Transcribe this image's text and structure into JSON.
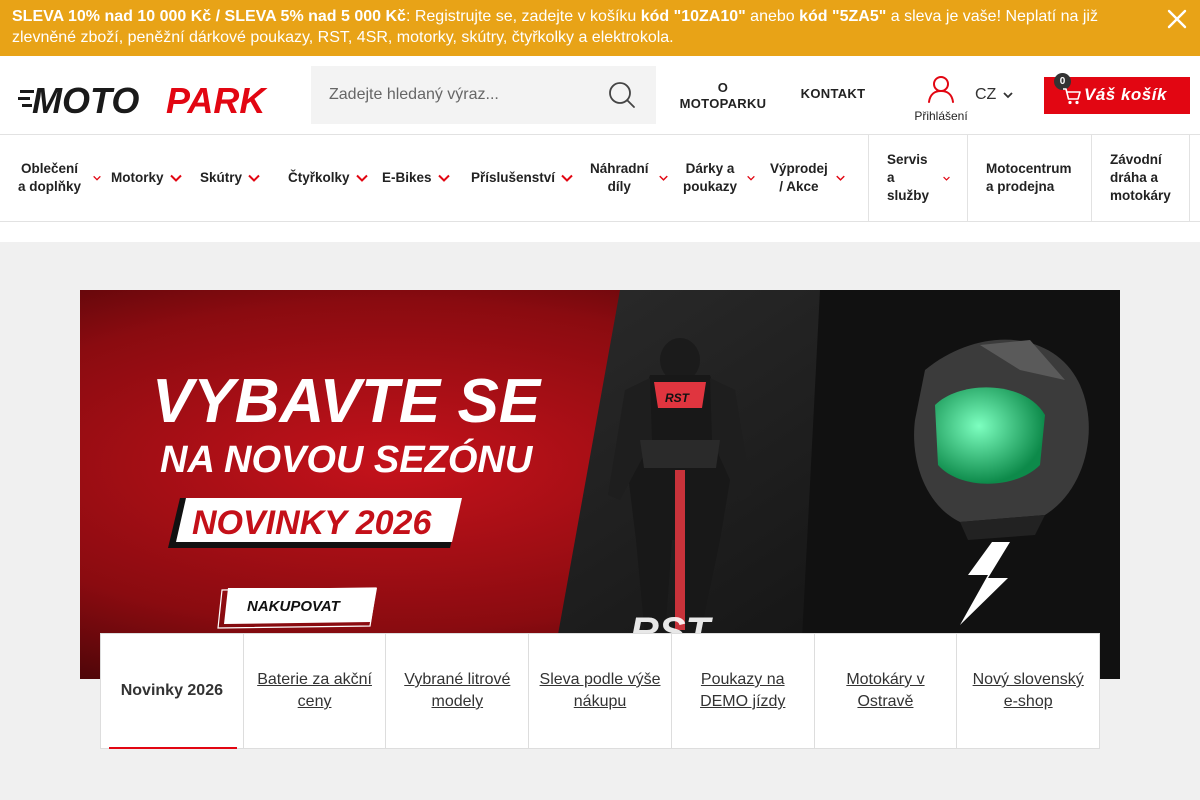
{
  "promo": {
    "bold_1": "SLEVA 10% nad 10 000 Kč / SLEVA 5% nad 5 000 Kč",
    "text_1": ": Registrujte se, zadejte v košíku ",
    "bold_2": "kód \"10ZA10\"",
    "text_2": " anebo ",
    "bold_3": "kód \"5ZA5\"",
    "text_3": " a sleva je vaše! Neplatí na již zlevněné zboží, peněžní dárkové poukazy, RST, 4SR, motorky, skútry, čtyřkolky a elektrokola."
  },
  "header": {
    "logo_text_1": "MOTO",
    "logo_text_2": "PARK",
    "search_placeholder": "Zadejte hledaný výraz...",
    "about_line1": "O",
    "about_line2": "MOTOPARKU",
    "contact": "KONTAKT",
    "login": "Přihlášení",
    "lang": "CZ",
    "cart_label": "Váš košík",
    "cart_count": "0"
  },
  "nav": {
    "items": [
      {
        "label_1": "Oblečení",
        "label_2": "a doplňky"
      },
      {
        "label_1": "Motorky",
        "label_2": ""
      },
      {
        "label_1": "Skútry",
        "label_2": ""
      },
      {
        "label_1": "Čtyřkolky",
        "label_2": ""
      },
      {
        "label_1": "E-Bikes",
        "label_2": ""
      },
      {
        "label_1": "Příslušenství",
        "label_2": ""
      },
      {
        "label_1": "Náhradní",
        "label_2": "díly"
      },
      {
        "label_1": "Dárky a",
        "label_2": "poukazy"
      },
      {
        "label_1": "Výprodej",
        "label_2": "/ Akce"
      }
    ],
    "boxes": [
      {
        "l1": "Servis",
        "l2": "a",
        "l3": "služby"
      },
      {
        "l1": "Motocentrum",
        "l2": "a prodejna",
        "l3": ""
      },
      {
        "l1": "Závodní",
        "l2": "dráha a",
        "l3": "motokáry"
      }
    ]
  },
  "banner": {
    "headline_1": "VYBAVTE SE",
    "headline_2": "NA NOVOU SEZÓNU",
    "badge": "NOVINKY 2026",
    "cta": "NAKUPOVAT",
    "suit_brand": "RST",
    "bottom_brand": "RST"
  },
  "tabs": [
    "Novinky 2026",
    "Baterie za akční ceny",
    "Vybrané litrové modely",
    "Sleva podle výše nákupu",
    "Poukazy na DEMO jízdy",
    "Motokáry v Ostravě",
    "Nový slovenský e-shop"
  ],
  "colors": {
    "promo_bg": "#e8a317",
    "brand_red": "#e20612",
    "dark": "#1a1a1a"
  }
}
